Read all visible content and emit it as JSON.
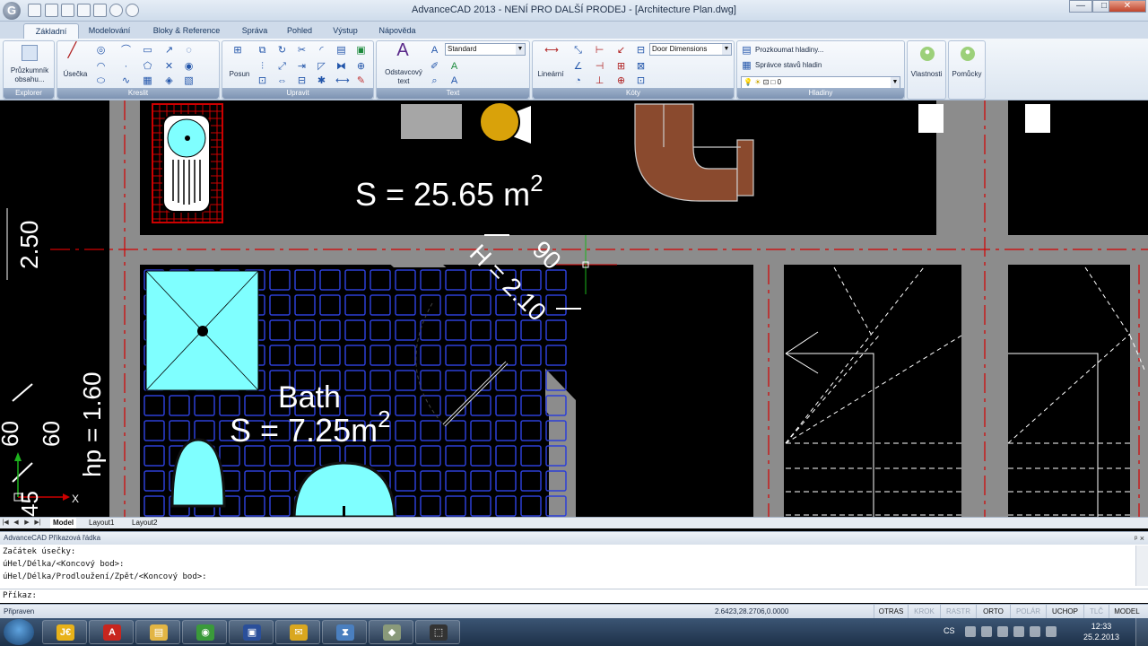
{
  "window": {
    "title": "AdvanceCAD 2013 - NENÍ PRO DALŠÍ PRODEJ - [Architecture Plan.dwg]",
    "min_label": "—",
    "max_label": "□",
    "close_label": "✕"
  },
  "app_logo": "G",
  "ribbon_tabs": [
    "Základní",
    "Modelování",
    "Bloky & Reference",
    "Správa",
    "Pohled",
    "Výstup",
    "Nápověda"
  ],
  "ribbon": {
    "explorer": {
      "button_label": "Průzkumník obsahu...",
      "group": "Explorer"
    },
    "draw": {
      "line_label": "Úsečka",
      "group": "Kreslit"
    },
    "modify": {
      "move_label": "Posun",
      "group": "Upravit"
    },
    "text": {
      "mtext_label": "Odstavcový text",
      "style_value": "Standard",
      "group": "Text"
    },
    "dimensions": {
      "linear_label": "Lineární",
      "style_value": "Door Dimensions",
      "group": "Kóty"
    },
    "layers": {
      "explore_label": "Prozkoumat hladiny...",
      "manager_label": "Správce stavů hladin",
      "current_layer": "0",
      "group": "Hladiny"
    },
    "properties_label": "Vlastnosti",
    "utilities_label": "Pomůcky"
  },
  "drawing": {
    "area_upper": "S = 25.65 m",
    "area_upper_sup": "2",
    "room_name": "Bath",
    "area_bath": "S = 7.25m",
    "area_bath_sup": "2",
    "door_width": "90",
    "door_height": "H = 2.10",
    "dim_vertical": "2.50",
    "dim_hp": "hp = 1.60",
    "dim_60_a": "60",
    "dim_60_b": "60",
    "dim_45": "45",
    "ucs_x": "X"
  },
  "layout_tabs": [
    "Model",
    "Layout1",
    "Layout2"
  ],
  "command": {
    "header": "AdvanceCAD Příkazová řádka",
    "header_buttons": "ᵖ ×",
    "history": [
      "Začátek úsečky:",
      "úHel/Délka/<Koncový bod>:",
      "úHel/Délka/Prodloužení/Zpět/<Koncový bod>:"
    ],
    "prompt": "Příkaz:"
  },
  "status": {
    "ready": "Připraven",
    "coordinates": "2.6423,28.2706,0.0000",
    "toggles": [
      {
        "label": "OTRAS",
        "on": true
      },
      {
        "label": "KROK",
        "on": false
      },
      {
        "label": "RASTR",
        "on": false
      },
      {
        "label": "ORTO",
        "on": true
      },
      {
        "label": "POLÁR",
        "on": false
      },
      {
        "label": "UCHOP",
        "on": true
      },
      {
        "label": "TLČ",
        "on": false
      },
      {
        "label": "MODEL",
        "on": true
      }
    ]
  },
  "taskbar": {
    "apps": [
      {
        "name": "jedit",
        "glyph": "J€",
        "color": "#e8b21a"
      },
      {
        "name": "acrobat",
        "glyph": "A",
        "color": "#c8261f"
      },
      {
        "name": "explorer",
        "glyph": "▤",
        "color": "#e2b544"
      },
      {
        "name": "chrome",
        "glyph": "◉",
        "color": "#3a9a3a"
      },
      {
        "name": "save-app",
        "glyph": "▣",
        "color": "#2a4f9a"
      },
      {
        "name": "mail",
        "glyph": "✉",
        "color": "#d9a71f"
      },
      {
        "name": "hourglass",
        "glyph": "⧗",
        "color": "#4a7fbf"
      },
      {
        "name": "cad",
        "glyph": "◆",
        "color": "#8a9a7a"
      },
      {
        "name": "capture",
        "glyph": "⬚",
        "color": "#333333"
      }
    ],
    "language": "CS",
    "time": "12:33",
    "date": "25.2.2013"
  }
}
